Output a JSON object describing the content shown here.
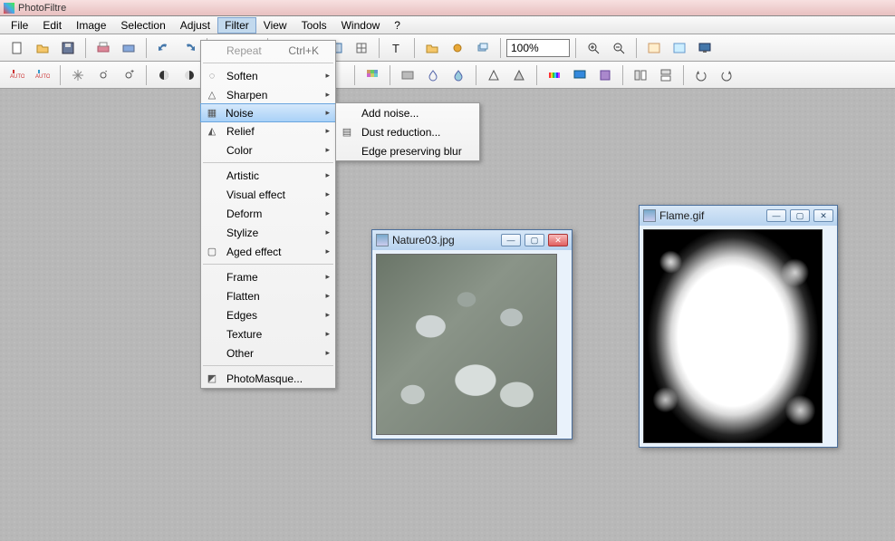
{
  "app": {
    "title": "PhotoFiltre"
  },
  "menubar": {
    "items": [
      {
        "label": "File"
      },
      {
        "label": "Edit"
      },
      {
        "label": "Image"
      },
      {
        "label": "Selection"
      },
      {
        "label": "Adjust"
      },
      {
        "label": "Filter",
        "active": true
      },
      {
        "label": "View"
      },
      {
        "label": "Tools"
      },
      {
        "label": "Window"
      },
      {
        "label": "?"
      }
    ]
  },
  "filter_menu": {
    "repeat": {
      "label": "Repeat",
      "shortcut": "Ctrl+K",
      "disabled": true
    },
    "soften": "Soften",
    "sharpen": "Sharpen",
    "noise": "Noise",
    "relief": "Relief",
    "color": "Color",
    "artistic": "Artistic",
    "visual_effect": "Visual effect",
    "deform": "Deform",
    "stylize": "Stylize",
    "aged_effect": "Aged effect",
    "frame": "Frame",
    "flatten": "Flatten",
    "edges": "Edges",
    "texture": "Texture",
    "other": "Other",
    "photomasque": "PhotoMasque..."
  },
  "noise_submenu": {
    "add_noise": "Add noise...",
    "dust_reduction": "Dust reduction...",
    "edge_preserving_blur": "Edge preserving blur"
  },
  "toolbar1": {
    "zoom_value": "100%"
  },
  "mdi": {
    "nature": {
      "title": "Nature03.jpg"
    },
    "flame": {
      "title": "Flame.gif"
    }
  }
}
